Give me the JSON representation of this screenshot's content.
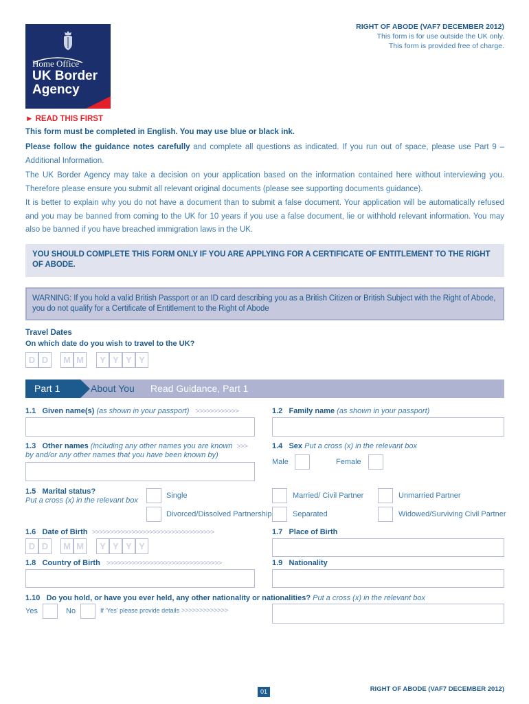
{
  "logo": {
    "line1": "Home Office",
    "line2": "UK Border",
    "line3": "Agency",
    "colors": {
      "navy": "#1a2f6c",
      "red": "#e3202a"
    }
  },
  "header": {
    "title": "RIGHT OF ABODE (VAF7 DECEMBER 2012)",
    "subtitle1": "This form is for use outside the UK only.",
    "subtitle2": "This form is provided free of charge."
  },
  "intro": {
    "read_first_icon": "triangle-right-icon",
    "read_first": "READ THIS FIRST",
    "p1": "This form must be completed in English. You may use blue or black ink.",
    "p2_bold": "Please follow the guidance notes carefully",
    "p2_rest": " and complete all questions as indicated. If you run out of space, please use Part 9 – Additional Information.",
    "p3": "The UK Border Agency may take a decision on your application based on the information contained here without interviewing you. Therefore please ensure you submit all relevant original documents (please see supporting documents guidance).",
    "p4": "It is better to explain why you do not have a document than to submit a false document. Your application will be automatically refused and you may be banned from coming to the UK for 10 years if you use a false document, lie or withhold relevant information. You may also be banned if you have breached immigration laws in the UK."
  },
  "notice": "YOU SHOULD COMPLETE THIS FORM ONLY IF YOU ARE APPLYING FOR A CERTIFICATE OF ENTITLEMENT TO THE RIGHT OF ABODE.",
  "warning": "WARNING: If you hold a valid British Passport or an ID card describing you as a British Citizen or British Subject with the Right of Abode, you do not qualify for a Certificate of Entitlement to the Right of Abode",
  "travel": {
    "heading": "Travel Dates",
    "question": "On which date do you wish to travel to the UK?",
    "date_placeholders": [
      "D",
      "D",
      "M",
      "M",
      "Y",
      "Y",
      "Y",
      "Y"
    ]
  },
  "part1": {
    "tag": "Part 1",
    "title": "About You",
    "guidance": "Read Guidance, Part 1",
    "q1_1": {
      "num": "1.1",
      "label": "Given name(s)",
      "hint": "(as shown in your passport)",
      "arrows": ">>>>>>>>>>>>",
      "value": ""
    },
    "q1_2": {
      "num": "1.2",
      "label": "Family name",
      "hint": "(as shown in your passport)",
      "value": ""
    },
    "q1_3": {
      "num": "1.3",
      "label": "Other names",
      "hint": "(including any other names you are known",
      "arrows": ">>>",
      "hint2": "by and/or any other names that you have been known by)",
      "value": ""
    },
    "q1_4": {
      "num": "1.4",
      "label": "Sex",
      "hint": "Put a cross (x) in the relevant box",
      "male": "Male",
      "female": "Female"
    },
    "q1_5": {
      "num": "1.5",
      "label": "Marital status?",
      "hint": "Put a cross (x) in the relevant box",
      "options": [
        "Single",
        "Married/ Civil Partner",
        "Unmarried Partner",
        "Divorced/Dissolved Partnership",
        "Separated",
        "Widowed/Surviving Civil Partner"
      ]
    },
    "q1_6": {
      "num": "1.6",
      "label": "Date of Birth",
      "arrows": ">>>>>>>>>>>>>>>>>>>>>>>>>>>>>>>>>>",
      "date_placeholders": [
        "D",
        "D",
        "M",
        "M",
        "Y",
        "Y",
        "Y",
        "Y"
      ]
    },
    "q1_7": {
      "num": "1.7",
      "label": "Place of Birth",
      "value": ""
    },
    "q1_8": {
      "num": "1.8",
      "label": "Country of Birth",
      "arrows": ">>>>>>>>>>>>>>>>>>>>>>>>>>>>>>>>",
      "value": ""
    },
    "q1_9": {
      "num": "1.9",
      "label": "Nationality",
      "value": ""
    },
    "q1_10": {
      "num": "1.10",
      "label": "Do you hold, or have you ever held, any other nationality or nationalities?",
      "hint": "Put a cross (x) in the relevant box",
      "yes": "Yes",
      "no": "No",
      "details": "If 'Yes' please provide details",
      "arrows": ">>>>>>>>>>>>>",
      "value": ""
    }
  },
  "footer": {
    "page": "01",
    "title": "RIGHT OF ABODE (VAF7 DECEMBER 2012)"
  }
}
